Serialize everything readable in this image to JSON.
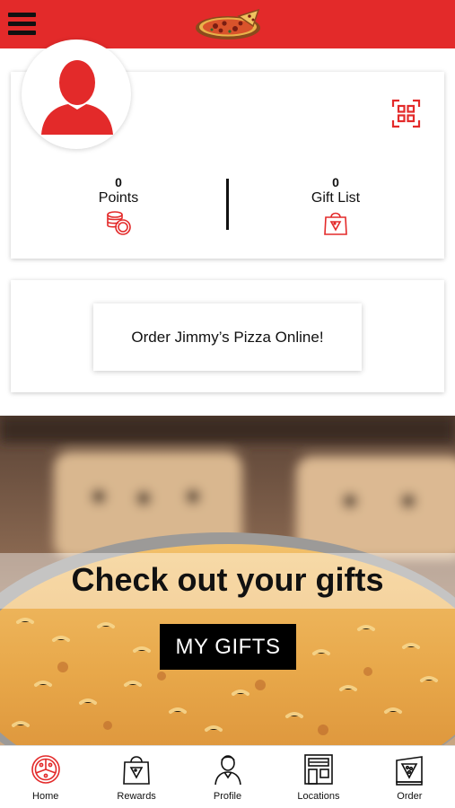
{
  "header": {
    "menu_icon": "hamburger-menu-icon",
    "logo_icon": "pizza-logo-icon",
    "accent_color": "#e32a2a"
  },
  "profile": {
    "avatar_icon": "user-silhouette-icon",
    "qr_icon": "qr-scan-icon",
    "points_value": "0",
    "points_label": "Points",
    "points_icon": "coins-icon",
    "gifts_value": "0",
    "gifts_label": "Gift List",
    "gifts_icon": "gift-bag-icon"
  },
  "order": {
    "button_label": "Order Jimmy’s Pizza Online!"
  },
  "banner": {
    "title": "Check out your gifts",
    "button_label": "MY GIFTS"
  },
  "bottom_nav": {
    "items": [
      {
        "label": "Home",
        "icon": "pizza-home-icon",
        "active": true
      },
      {
        "label": "Rewards",
        "icon": "rewards-bag-icon"
      },
      {
        "label": "Profile",
        "icon": "profile-person-icon"
      },
      {
        "label": "Locations",
        "icon": "storefront-icon"
      },
      {
        "label": "Order",
        "icon": "pizza-box-icon"
      }
    ]
  }
}
